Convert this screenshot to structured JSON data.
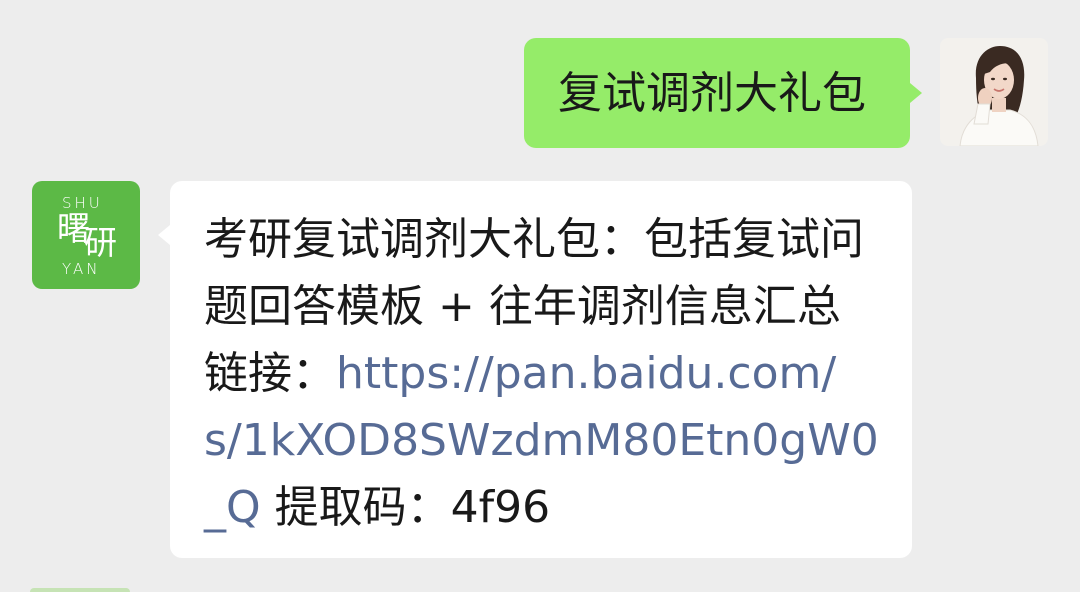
{
  "colors": {
    "background": "#ededed",
    "sent_bubble": "#95ec69",
    "received_bubble": "#ffffff",
    "text": "#191919",
    "link": "#576b95",
    "logo_green": "#5cb946"
  },
  "sent_message": {
    "avatar_icon": "user-photo-avatar",
    "text": "复试调剂大礼包"
  },
  "received_message": {
    "avatar": {
      "icon": "shuyan-logo-avatar",
      "logo_top": "SHU",
      "logo_char_1": "曙",
      "logo_char_2": "研",
      "logo_bottom": "YAN"
    },
    "lines": [
      {
        "text": "考研复试调剂大礼包：包括复试问"
      },
      {
        "text": "题回答模板 + 往年调剂信息汇总"
      }
    ],
    "link_label": "链接：",
    "link_segments": [
      "https://pan.baidu.com/",
      "s/1kXOD8SWzdmM80Etn0gW0",
      "_Q"
    ],
    "code_label": "提取码：",
    "code": "4f96"
  }
}
